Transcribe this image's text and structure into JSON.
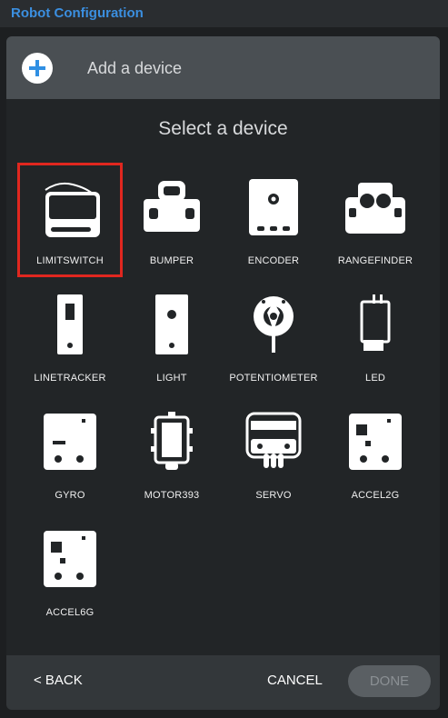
{
  "app": {
    "title": "Robot Configuration"
  },
  "dialog": {
    "header_title": "Add a device",
    "subtitle": "Select a device"
  },
  "devices": [
    {
      "label": "LIMITSWITCH",
      "icon": "limitswitch-icon",
      "selected": true
    },
    {
      "label": "BUMPER",
      "icon": "bumper-icon"
    },
    {
      "label": "ENCODER",
      "icon": "encoder-icon"
    },
    {
      "label": "RANGEFINDER",
      "icon": "rangefinder-icon"
    },
    {
      "label": "LINETRACKER",
      "icon": "linetracker-icon"
    },
    {
      "label": "LIGHT",
      "icon": "light-icon"
    },
    {
      "label": "POTENTIOMETER",
      "icon": "potentiometer-icon"
    },
    {
      "label": "LED",
      "icon": "led-icon"
    },
    {
      "label": "GYRO",
      "icon": "gyro-icon"
    },
    {
      "label": "MOTOR393",
      "icon": "motor393-icon"
    },
    {
      "label": "SERVO",
      "icon": "servo-icon"
    },
    {
      "label": "ACCEL2G",
      "icon": "accel2g-icon"
    },
    {
      "label": "ACCEL6G",
      "icon": "accel6g-icon"
    }
  ],
  "footer": {
    "back_label": "< BACK",
    "cancel_label": "CANCEL",
    "done_label": "DONE"
  },
  "colors": {
    "accent": "#3b8fe0",
    "selection": "#e0271f",
    "background": "#1d1f21"
  }
}
